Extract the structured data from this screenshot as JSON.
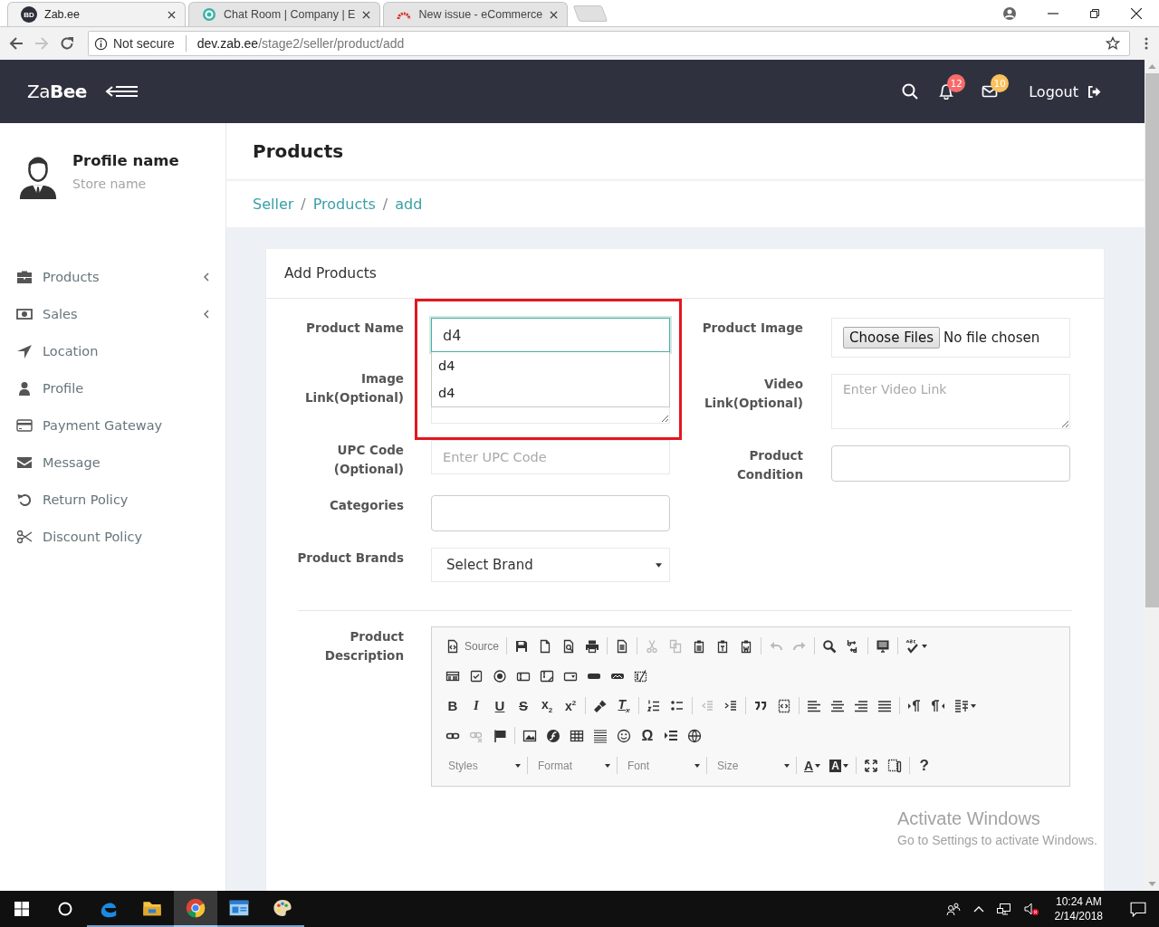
{
  "browser": {
    "tabs": [
      {
        "title": "Zab.ee",
        "kind": "zabee",
        "favicon_text": "BD",
        "selected": true
      },
      {
        "title": "Chat Room | Company | E",
        "kind": "chat",
        "selected": false
      },
      {
        "title": "New issue - eCommerce",
        "kind": "issue",
        "selected": false
      }
    ],
    "address": {
      "security": "Not secure",
      "host": "dev.zab.ee",
      "path": "/stage2/seller/product/add"
    }
  },
  "header": {
    "logo": "Za**Bee**",
    "notifications": [
      {
        "kind": "bell",
        "count": "12",
        "color": "#f96b6b"
      },
      {
        "kind": "mail",
        "count": "10",
        "color": "#fbc15e"
      }
    ],
    "logout": "Logout"
  },
  "sidebar": {
    "profile_name": "Profile name",
    "store_name": "Store name",
    "items": [
      {
        "label": "Products",
        "kind": "briefcase",
        "has_submenu": true
      },
      {
        "label": "Sales",
        "kind": "money",
        "has_submenu": true
      },
      {
        "label": "Location",
        "kind": "location",
        "has_submenu": false
      },
      {
        "label": "Profile",
        "kind": "user",
        "has_submenu": false
      },
      {
        "label": "Payment Gateway",
        "kind": "card",
        "has_submenu": false
      },
      {
        "label": "Message",
        "kind": "envelope",
        "has_submenu": false
      },
      {
        "label": "Return Policy",
        "kind": "return",
        "has_submenu": false
      },
      {
        "label": "Discount Policy",
        "kind": "scissors",
        "has_submenu": false
      }
    ]
  },
  "page": {
    "title": "Products",
    "breadcrumb": [
      {
        "kind": "link",
        "text": "Seller"
      },
      {
        "kind": "separator",
        "text": "/"
      },
      {
        "kind": "link",
        "text": "Products"
      },
      {
        "kind": "separator",
        "text": "/"
      },
      {
        "kind": "link",
        "text": "add"
      }
    ]
  },
  "card": {
    "title": "Add Products",
    "left_fields": [
      {
        "kind": "text",
        "label": "Product Name",
        "value": "d4",
        "focused": true,
        "highlighted": true,
        "suggestions": [
          "d4",
          "d4"
        ]
      },
      {
        "kind": "textarea",
        "label": "Image Link(Optional)",
        "highlighted": false
      },
      {
        "kind": "text",
        "label": "UPC Code (Optional)",
        "placeholder": "Enter UPC Code",
        "focused": false,
        "highlighted": false
      },
      {
        "kind": "input",
        "label": "Categories",
        "focused": false,
        "highlighted": false
      },
      {
        "kind": "select",
        "label": "Product Brands",
        "value": "Select Brand",
        "highlighted": false
      }
    ],
    "right_fields": [
      {
        "kind": "file",
        "label": "Product Image",
        "button": "Choose Files",
        "status": "No file chosen"
      },
      {
        "kind": "textarea",
        "label": "Video Link(Optional)",
        "placeholder": "Enter Video Link"
      },
      {
        "kind": "input",
        "label": "Product Condition"
      }
    ],
    "description": {
      "label": "Product Description",
      "toolbar": [
        [
          [
            {
              "kind": "source",
              "label": "Source",
              "disabled": false
            }
          ],
          [
            {
              "kind": "save",
              "disabled": false
            },
            {
              "kind": "newpage",
              "disabled": false
            },
            {
              "kind": "preview",
              "disabled": false
            },
            {
              "kind": "print",
              "disabled": false
            }
          ],
          [
            {
              "kind": "templates",
              "disabled": false
            }
          ],
          [
            {
              "kind": "cut",
              "disabled": true
            },
            {
              "kind": "copy",
              "disabled": true
            },
            {
              "kind": "paste",
              "disabled": false
            },
            {
              "kind": "pastetext",
              "disabled": false
            },
            {
              "kind": "pasteword",
              "disabled": false
            }
          ],
          [
            {
              "kind": "undo",
              "disabled": true
            },
            {
              "kind": "redo",
              "disabled": true
            }
          ],
          [
            {
              "kind": "find",
              "disabled": false
            },
            {
              "kind": "replace",
              "disabled": false
            }
          ],
          [
            {
              "kind": "selectall",
              "disabled": false
            }
          ],
          [
            {
              "kind": "spell",
              "disabled": false
            }
          ]
        ],
        [
          [
            {
              "kind": "form",
              "disabled": false
            },
            {
              "kind": "checkbox",
              "disabled": false
            },
            {
              "kind": "radio",
              "disabled": false
            },
            {
              "kind": "textfield",
              "disabled": false
            },
            {
              "kind": "textarea",
              "disabled": false
            },
            {
              "kind": "select",
              "disabled": false
            },
            {
              "kind": "button",
              "disabled": false
            },
            {
              "kind": "imagebutton",
              "disabled": false
            },
            {
              "kind": "hiddenfield",
              "disabled": false
            }
          ]
        ],
        [
          [
            {
              "kind": "bold",
              "label": "B",
              "disabled": false
            },
            {
              "kind": "italic",
              "label": "I",
              "disabled": false
            },
            {
              "kind": "underline",
              "label": "U",
              "disabled": false
            },
            {
              "kind": "strike",
              "label": "S",
              "disabled": false
            },
            {
              "kind": "subscript",
              "label": "x$_{2}$",
              "disabled": false
            },
            {
              "kind": "superscript",
              "label": "x$^{2}$",
              "disabled": false
            }
          ],
          [
            {
              "kind": "copyformat",
              "disabled": false
            },
            {
              "kind": "removeformat",
              "label": "T$_{x}$",
              "disabled": false
            }
          ],
          [
            {
              "kind": "numlist",
              "disabled": false
            },
            {
              "kind": "bulletlist",
              "disabled": false
            }
          ],
          [
            {
              "kind": "outdent",
              "disabled": true
            },
            {
              "kind": "indent",
              "disabled": false
            }
          ],
          [
            {
              "kind": "blockquote",
              "disabled": false
            },
            {
              "kind": "div",
              "disabled": false
            }
          ],
          [
            {
              "kind": "alignleft",
              "disabled": false
            },
            {
              "kind": "aligncenter",
              "disabled": false
            },
            {
              "kind": "alignright",
              "disabled": false
            },
            {
              "kind": "justify",
              "disabled": false
            }
          ],
          [
            {
              "kind": "ltr",
              "disabled": false
            },
            {
              "kind": "rtl",
              "disabled": false
            },
            {
              "kind": "language",
              "disabled": false
            }
          ]
        ],
        [
          [
            {
              "kind": "link",
              "disabled": false
            },
            {
              "kind": "unlink",
              "disabled": true
            },
            {
              "kind": "anchor",
              "disabled": false
            }
          ],
          [
            {
              "kind": "image",
              "disabled": false
            },
            {
              "kind": "flash",
              "disabled": false
            },
            {
              "kind": "table",
              "disabled": false
            },
            {
              "kind": "hr",
              "disabled": false
            },
            {
              "kind": "smiley",
              "disabled": false
            },
            {
              "kind": "specialchar",
              "label": "Ω",
              "disabled": false
            },
            {
              "kind": "pagebreak",
              "disabled": false
            },
            {
              "kind": "iframe",
              "disabled": false
            }
          ]
        ],
        [
          [
            {
              "kind": "combo",
              "label": "Styles",
              "disabled": false
            }
          ],
          [
            {
              "kind": "combo",
              "label": "Format",
              "disabled": false
            }
          ],
          [
            {
              "kind": "combo",
              "label": "Font",
              "disabled": false
            }
          ],
          [
            {
              "kind": "combo",
              "label": "Size",
              "disabled": false
            }
          ],
          [
            {
              "kind": "textcolor",
              "label": "A",
              "disabled": false
            },
            {
              "kind": "bgcolor",
              "label": "A",
              "disabled": false
            }
          ],
          [
            {
              "kind": "maximize",
              "disabled": false
            },
            {
              "kind": "showblocks",
              "disabled": false
            }
          ],
          [
            {
              "kind": "help",
              "label": "?",
              "disabled": false
            }
          ]
        ]
      ]
    }
  },
  "os_overlay": {
    "title": "Activate Windows",
    "text": "Go to Settings to activate Windows."
  },
  "taskbar": {
    "apps": [
      {
        "kind": "edge",
        "selected": false
      },
      {
        "kind": "explorer",
        "selected": false
      },
      {
        "kind": "chrome",
        "selected": true
      },
      {
        "kind": "window",
        "selected": false
      },
      {
        "kind": "paint",
        "selected": false
      }
    ],
    "time": "10:24 AM",
    "date": "2/14/2018"
  }
}
